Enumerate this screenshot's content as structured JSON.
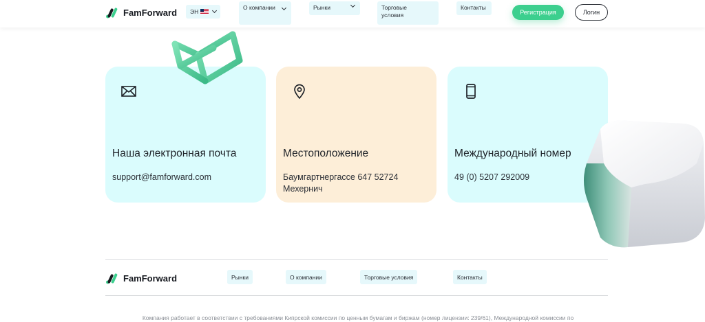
{
  "header": {
    "brand": "FamForward",
    "lang": "ЭН",
    "nav": {
      "company": "О компании",
      "markets": "Рынки",
      "terms": "Торговые условия",
      "contacts": "Контакты"
    },
    "register": "Регистрация",
    "login": "Логин"
  },
  "cards": {
    "email": {
      "icon": "envelope-icon",
      "title": "Наша электронная почта",
      "value": "support@famforward.com"
    },
    "location": {
      "icon": "map-pin-icon",
      "title": "Местоположение",
      "value": "Баумгартнергассе 647 52724 Мехернич"
    },
    "phone": {
      "icon": "smartphone-icon",
      "title": "Международный номер",
      "value": "49 (0) 5207 292009"
    }
  },
  "footer": {
    "brand": "FamForward",
    "links": {
      "markets": "Рынки",
      "company": "О компании",
      "terms": "Торговые условия",
      "contacts": "Контакты"
    },
    "legal": "Компания работает в соответствии с требованиями Кипрской комиссии по ценным бумагам и биржам (номер лицензии: 239/61), Международной комиссии по"
  },
  "colors": {
    "accent": "#3ccf8e",
    "card_cyan": "#dafcfd",
    "card_peach": "#fdeed8"
  }
}
